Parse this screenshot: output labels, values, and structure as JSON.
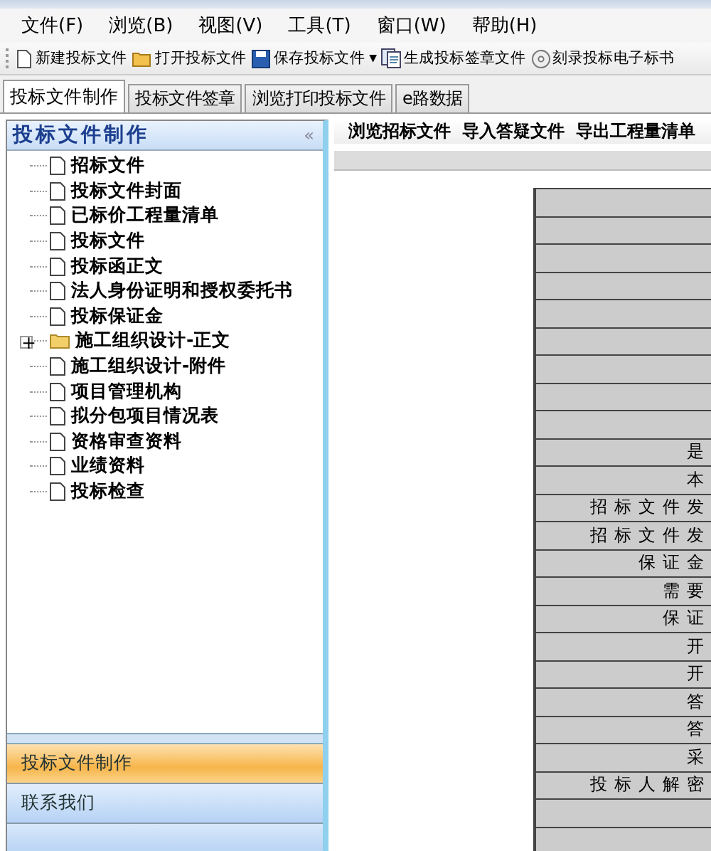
{
  "menu": [
    "文件(F)",
    "浏览(B)",
    "视图(V)",
    "工具(T)",
    "窗口(W)",
    "帮助(H)"
  ],
  "toolbar": [
    {
      "label": "新建投标文件",
      "kind": "new"
    },
    {
      "label": "打开投标文件",
      "kind": "open"
    },
    {
      "label": "保存投标文件",
      "kind": "save",
      "dropdown": "▼"
    },
    {
      "label": "生成投标签章文件",
      "kind": "sign"
    },
    {
      "label": "刻录投标电子标书",
      "kind": "disc"
    }
  ],
  "tabs": [
    {
      "label": "投标文件制作",
      "selected": true
    },
    {
      "label": "投标文件签章",
      "selected": false
    },
    {
      "label": "浏览打印投标文件",
      "selected": false
    },
    {
      "label": "e路数据",
      "selected": false
    }
  ],
  "sidebar": {
    "title": "投标文件制作",
    "collapse": "«",
    "tree": [
      {
        "label": "招标文件",
        "kind": "file"
      },
      {
        "label": "投标文件封面",
        "kind": "file"
      },
      {
        "label": "已标价工程量清单",
        "kind": "file"
      },
      {
        "label": "投标文件",
        "kind": "file"
      },
      {
        "label": "投标函正文",
        "kind": "file"
      },
      {
        "label": "法人身份证明和授权委托书",
        "kind": "file"
      },
      {
        "label": "投标保证金",
        "kind": "file"
      },
      {
        "label": "施工组织设计-正文",
        "kind": "folder",
        "expander": "+"
      },
      {
        "label": "施工组织设计-附件",
        "kind": "file"
      },
      {
        "label": "项目管理机构",
        "kind": "file"
      },
      {
        "label": "拟分包项目情况表",
        "kind": "file"
      },
      {
        "label": "资格审查资料",
        "kind": "file"
      },
      {
        "label": "业绩资料",
        "kind": "file"
      },
      {
        "label": "投标检查",
        "kind": "file"
      }
    ],
    "nav": [
      {
        "label": "投标文件制作",
        "selected": true
      },
      {
        "label": "联系我们",
        "selected": false
      }
    ]
  },
  "main": {
    "actions": [
      "浏览招标文件",
      "导入答疑文件",
      "导出工程量清单"
    ],
    "rows": [
      "",
      "",
      "",
      "",
      "",
      "",
      "",
      "",
      "",
      "是",
      "本",
      "招标文件发",
      "招标文件发",
      "保证金",
      "需要",
      "保证",
      "开",
      "开",
      "答",
      "答",
      "采",
      "投标人解密",
      "",
      ""
    ]
  }
}
